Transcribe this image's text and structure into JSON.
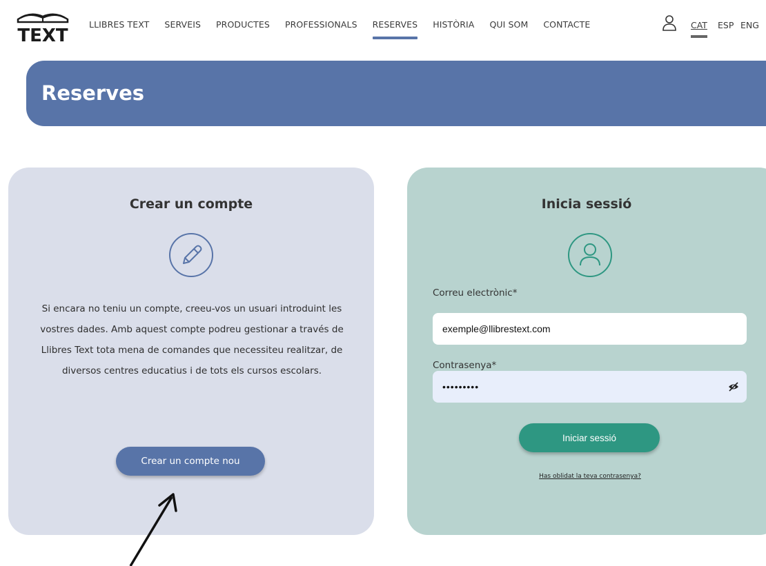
{
  "header": {
    "logo_text": "TEXT",
    "nav": [
      {
        "label": "LLIBRES TEXT"
      },
      {
        "label": "SERVEIS"
      },
      {
        "label": "PRODUCTES"
      },
      {
        "label": "PROFESSIONALS"
      },
      {
        "label": "RESERVES",
        "active": true
      },
      {
        "label": "HISTÒRIA"
      },
      {
        "label": "QUI SOM"
      },
      {
        "label": "CONTACTE"
      }
    ],
    "user_icon": "user-icon",
    "languages": [
      "CAT",
      "ESP",
      "ENG"
    ],
    "active_language": "CAT"
  },
  "banner": {
    "title": "Reserves"
  },
  "register": {
    "title": "Crear un compte",
    "icon": "pencil-icon",
    "description": "Si encara no teniu un compte, creeu-vos un usuari introduint les vostres dades. Amb aquest compte podreu gestionar a través de Llibres Text tota mena de comandes que necessiteu realitzar, de diversos centres educatius i de tots els cursos escolars.",
    "button_label": "Crear un compte nou"
  },
  "login": {
    "title": "Inicia sessió",
    "icon": "user-circle-icon",
    "email_label": "Correu electrònic*",
    "email_value": "exemple@llibrestext.com",
    "password_label": "Contrasenya*",
    "password_value": "•••••••••",
    "eye_icon": "eye-slash-icon",
    "button_label": "Iniciar sessió",
    "forgot_label": "Has oblidat la teva contrasenya?"
  },
  "colors": {
    "primary_blue": "#5874a8",
    "primary_green": "#2e9782",
    "card_left_bg": "#dadeea",
    "card_right_bg": "#b8d3cf"
  }
}
